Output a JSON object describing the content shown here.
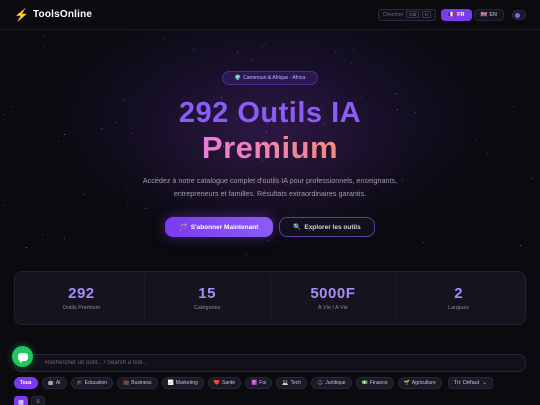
{
  "header": {
    "logo_text": "ToolsOnline",
    "shortcut_label": "Chercher",
    "shortcut_keys": [
      "Ctrl",
      "K"
    ],
    "languages": [
      {
        "flag": "🇫🇷",
        "code": "FR",
        "active": true
      },
      {
        "flag": "🇬🇧",
        "code": "EN",
        "active": false
      }
    ]
  },
  "hero": {
    "badge_icon": "🌍",
    "badge_text": "Cameroun & Afrique · Africa",
    "title_line1": "292 Outils IA",
    "title_line2": "Premium",
    "subtitle": "Accédez à notre catalogue complet d'outils IA pour professionnels, enseignants, entrepreneurs et familles. Résultats extraordinaires garantis.",
    "primary_cta_icon": "🪄",
    "primary_cta": "S'abonner Maintenant",
    "secondary_cta_icon": "🔍",
    "secondary_cta": "Explorer les outils"
  },
  "stats": [
    {
      "value": "292",
      "label": "Outils Premium"
    },
    {
      "value": "15",
      "label": "Catégories"
    },
    {
      "value": "5000F",
      "label": "À Vie / A Vie"
    },
    {
      "value": "2",
      "label": "Langues"
    }
  ],
  "search": {
    "placeholder": "Rechercher un outil... / Search a tool..."
  },
  "filters": [
    {
      "icon": "",
      "label": "Tous",
      "active": true
    },
    {
      "icon": "🤖",
      "label": "AI",
      "active": false
    },
    {
      "icon": "🎓",
      "label": "Education",
      "active": false
    },
    {
      "icon": "💼",
      "label": "Business",
      "active": false
    },
    {
      "icon": "📈",
      "label": "Marketing",
      "active": false
    },
    {
      "icon": "❤️",
      "label": "Santé",
      "active": false
    },
    {
      "icon": "✝️",
      "label": "Foi",
      "active": false
    },
    {
      "icon": "💻",
      "label": "Tech",
      "active": false
    },
    {
      "icon": "⚖️",
      "label": "Juridique",
      "active": false
    },
    {
      "icon": "💵",
      "label": "Finance",
      "active": false
    },
    {
      "icon": "🌱",
      "label": "Agriculture",
      "active": false
    }
  ],
  "sort": {
    "label": "Tri: Défaut"
  },
  "colors": {
    "accent": "#7c3aed",
    "chat": "#22c55e"
  }
}
